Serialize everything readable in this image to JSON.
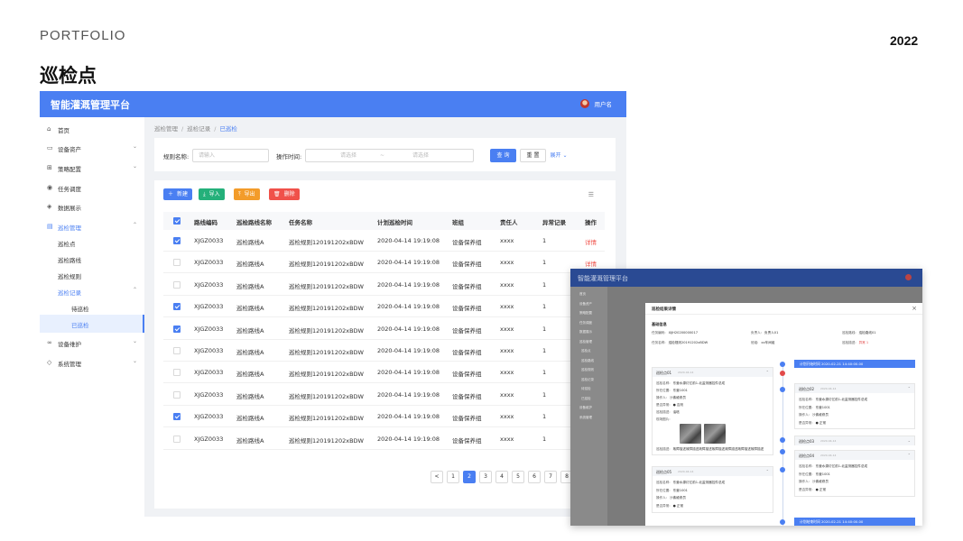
{
  "header": {
    "portfolio": "PORTFOLIO",
    "year": "2022",
    "page_title": "巡检点"
  },
  "app": {
    "title": "智能灌溉管理平台",
    "user": "用户名"
  },
  "sidebar": {
    "items": [
      {
        "label": "首页",
        "icon": "home-icon"
      },
      {
        "label": "设备资产",
        "icon": "monitor-icon"
      },
      {
        "label": "策略配置",
        "icon": "grid-icon"
      },
      {
        "label": "任务调度",
        "icon": "target-icon"
      },
      {
        "label": "数据展示",
        "icon": "cube-icon"
      },
      {
        "label": "巡检管理",
        "icon": "document-icon"
      },
      {
        "label": "巡检点"
      },
      {
        "label": "巡检路线"
      },
      {
        "label": "巡检规则"
      },
      {
        "label": "巡检记录"
      },
      {
        "label": "待巡检"
      },
      {
        "label": "已巡检"
      },
      {
        "label": "设备维护",
        "icon": "link-icon"
      },
      {
        "label": "系统管理",
        "icon": "shield-icon"
      }
    ]
  },
  "breadcrumb": {
    "level1": "巡检管理",
    "level2": "巡检记录",
    "current": "已巡检",
    "sep": "/"
  },
  "filter": {
    "rule_label": "规则名称:",
    "rule_placeholder": "请输入",
    "time_label": "操作时间:",
    "start_placeholder": "请选择",
    "range_sep": "~",
    "end_placeholder": "请选择",
    "query": "查 询",
    "reset": "重 置",
    "expand": "展开"
  },
  "toolbar": {
    "new": "新建",
    "import": "导入",
    "export": "导出",
    "delete": "删除"
  },
  "colors": {
    "primary": "#4a7ff2",
    "new": "#4a7ff2",
    "import": "#24b07a",
    "export": "#f39c2a",
    "delete": "#f0514a",
    "detail": "#f0514a"
  },
  "table": {
    "headers": [
      "路线编码",
      "巡检路线名称",
      "任务名称",
      "计划巡检时间",
      "班组",
      "责任人",
      "异常记录",
      "操作"
    ],
    "rows": [
      {
        "code": "XJGZ0033",
        "route": "巡检路线A",
        "task": "巡检规则120191202xBDW",
        "time": "2020-04-14 19:19:08",
        "team": "设备保养组",
        "owner": "xxxx",
        "abnormal": "1",
        "op": "详情",
        "checked": true
      },
      {
        "code": "XJGZ0033",
        "route": "巡检路线A",
        "task": "巡检规则120191202xBDW",
        "time": "2020-04-14 19:19:08",
        "team": "设备保养组",
        "owner": "xxxx",
        "abnormal": "1",
        "op": "详情",
        "checked": false
      },
      {
        "code": "XJGZ0033",
        "route": "巡检路线A",
        "task": "巡检规则120191202xBDW",
        "time": "2020-04-14 19:19:08",
        "team": "设备保养组",
        "owner": "xxxx",
        "abnormal": "1",
        "op": "",
        "checked": false
      },
      {
        "code": "XJGZ0033",
        "route": "巡检路线A",
        "task": "巡检规则120191202xBDW",
        "time": "2020-04-14 19:19:08",
        "team": "设备保养组",
        "owner": "xxxx",
        "abnormal": "1",
        "op": "",
        "checked": true
      },
      {
        "code": "XJGZ0033",
        "route": "巡检路线A",
        "task": "巡检规则120191202xBDW",
        "time": "2020-04-14 19:19:08",
        "team": "设备保养组",
        "owner": "xxxx",
        "abnormal": "1",
        "op": "",
        "checked": true
      },
      {
        "code": "XJGZ0033",
        "route": "巡检路线A",
        "task": "巡检规则120191202xBDW",
        "time": "2020-04-14 19:19:08",
        "team": "设备保养组",
        "owner": "xxxx",
        "abnormal": "1",
        "op": "",
        "checked": false
      },
      {
        "code": "XJGZ0033",
        "route": "巡检路线A",
        "task": "巡检规则120191202xBDW",
        "time": "2020-04-14 19:19:08",
        "team": "设备保养组",
        "owner": "xxxx",
        "abnormal": "1",
        "op": "",
        "checked": false
      },
      {
        "code": "XJGZ0033",
        "route": "巡检路线A",
        "task": "巡检规则120191202xBDW",
        "time": "2020-04-14 19:19:08",
        "team": "设备保养组",
        "owner": "xxxx",
        "abnormal": "1",
        "op": "",
        "checked": false
      },
      {
        "code": "XJGZ0033",
        "route": "巡检路线A",
        "task": "巡检规则120191202xBDW",
        "time": "2020-04-14 19:19:08",
        "team": "设备保养组",
        "owner": "xxxx",
        "abnormal": "1",
        "op": "",
        "checked": true
      },
      {
        "code": "XJGZ0033",
        "route": "巡检路线A",
        "task": "巡检规则120191202xBDW",
        "time": "2020-04-14 19:19:08",
        "team": "设备保养组",
        "owner": "xxxx",
        "abnormal": "1",
        "op": "",
        "checked": false
      }
    ]
  },
  "pagination": {
    "prev": "<",
    "pages": [
      "1",
      "2",
      "3",
      "4",
      "5",
      "6",
      "7",
      "8"
    ],
    "current": "2"
  },
  "detail": {
    "app_title": "智能灌溉管理平台",
    "modal_title": "巡检结果详情",
    "section": "基础信息",
    "info": [
      {
        "k": "任务编码:",
        "v": "XJJH20200000017"
      },
      {
        "k": "负责人:",
        "v": "负责人01"
      },
      {
        "k": "巡检路线:",
        "v": "巡检路线01"
      },
      {
        "k": "任务名称:",
        "v": "巡检规则20191202xBDW"
      },
      {
        "k": "班组:",
        "v": "xx车间组"
      },
      {
        "k": "巡检描述:",
        "v": "异常 1"
      }
    ],
    "point1": {
      "name": "巡检点01",
      "date": "2020-04-14",
      "rows": [
        {
          "k": "巡检名称:",
          "v": "东营水源灯亿前1-北监测器控件总成"
        },
        {
          "k": "所在位置:",
          "v": "东营1001"
        },
        {
          "k": "操作人:",
          "v": "沙弗维修员"
        },
        {
          "k": "是否异常:",
          "v": "● 否则"
        },
        {
          "k": "巡检描述:",
          "v": "油塔"
        },
        {
          "k": "现场图片:",
          "v": ""
        },
        {
          "k": "巡检描述:",
          "v": "故障描述故障描述故障描述故障描述故障描述故障描述故障描述"
        }
      ]
    },
    "point5": {
      "name": "巡检点05",
      "date": "2020-04-14",
      "rows": [
        {
          "k": "巡检名称:",
          "v": "东营水源灯亿前1-北监测器控件总成"
        },
        {
          "k": "所在位置:",
          "v": "东营1001"
        },
        {
          "k": "操作人:",
          "v": "沙弗维修员"
        },
        {
          "k": "是否异常:",
          "v": "● 正常"
        }
      ]
    },
    "timeline_start": "计划开始时间  2020-02-21  14:40:00.00",
    "point2": {
      "name": "巡检点02",
      "date": "2020-04-14",
      "rows": [
        {
          "k": "巡检名称:",
          "v": "东营水源灯亿前1-北监测器控件总成"
        },
        {
          "k": "所在位置:",
          "v": "东营1001"
        },
        {
          "k": "操作人:",
          "v": "沙弗维修员"
        },
        {
          "k": "是否异常:",
          "v": "● 正常"
        }
      ]
    },
    "point3": {
      "name": "巡检点03",
      "date": "2020-04-14"
    },
    "point4": {
      "name": "巡检点04",
      "date": "2020-04-14",
      "rows": [
        {
          "k": "巡检名称:",
          "v": "东营水源灯亿前1-北监测器控件总成"
        },
        {
          "k": "所在位置:",
          "v": "东营1001"
        },
        {
          "k": "操作人:",
          "v": "沙弗维修员"
        },
        {
          "k": "是否异常:",
          "v": "● 正常"
        }
      ]
    },
    "timeline_end": "计划结束时间  2020-02-21  14:40:00.00",
    "bg_sidebar": [
      "首页",
      "设备资产",
      "策略配置",
      "任务调度",
      "数据展示",
      "巡检管理",
      "巡检点",
      "巡检路线",
      "巡检规则",
      "巡检记录",
      "待巡检",
      "已巡检",
      "设备维护",
      "系统管理"
    ]
  }
}
